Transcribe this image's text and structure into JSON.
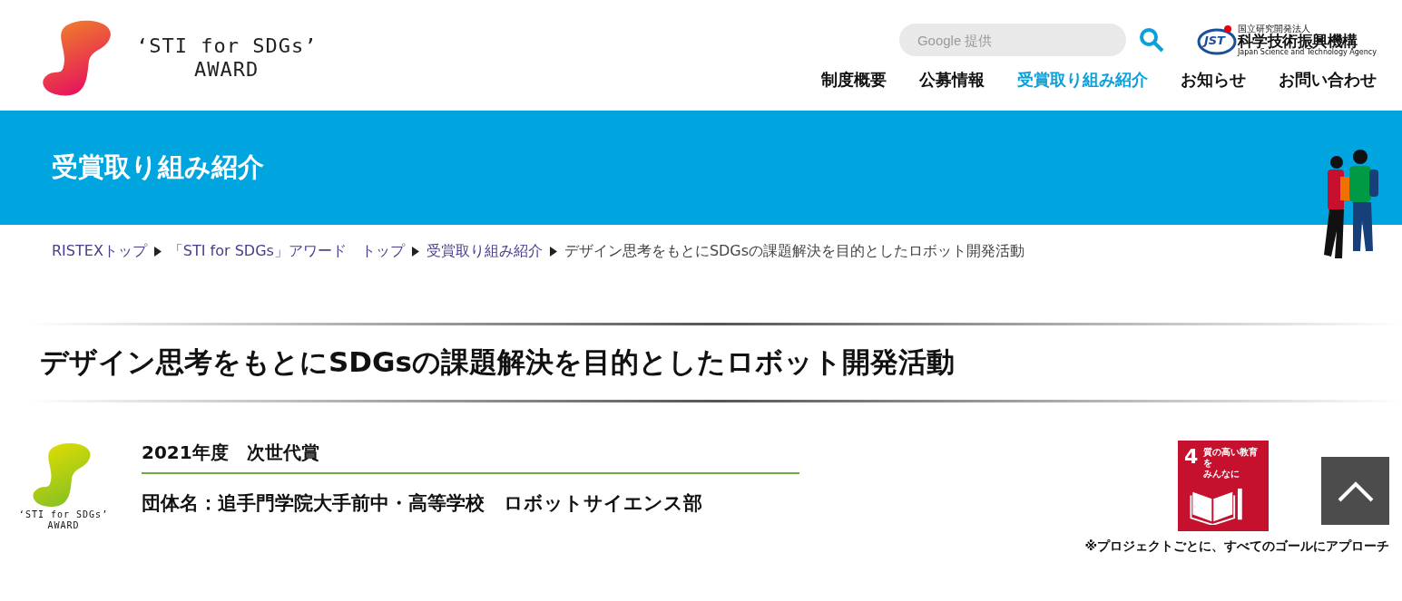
{
  "header": {
    "logo": {
      "line1": "‘STI for SDGs’",
      "line2": "AWARD"
    },
    "search": {
      "placeholder": "Google 提供"
    },
    "org": {
      "small": "国立研究開発法人",
      "name": "科学技術振興機構",
      "english": "Japan Science and Technology Agency",
      "mark": "JST"
    },
    "nav": [
      {
        "label": "制度概要",
        "selected": false
      },
      {
        "label": "公募情報",
        "selected": false
      },
      {
        "label": "受賞取り組み紹介",
        "selected": true
      },
      {
        "label": "お知らせ",
        "selected": false
      },
      {
        "label": "お問い合わせ",
        "selected": false
      }
    ]
  },
  "banner": {
    "title": "受賞取り組み紹介"
  },
  "breadcrumb": [
    {
      "label": "RISTEXトップ",
      "current": false
    },
    {
      "label": "「STI for SDGs」アワード　トップ",
      "current": false
    },
    {
      "label": "受賞取り組み紹介",
      "current": false
    },
    {
      "label": "デザイン思考をもとにSDGsの課題解決を目的としたロボット開発活動",
      "current": true
    }
  ],
  "page_title": "デザイン思考をもとにSDGsの課題解決を目的としたロボット開発活動",
  "award": {
    "logo": {
      "line1": "‘STI for SDGs’",
      "line2": "AWARD"
    },
    "category": "2021年度　次世代賞",
    "group": "団体名：追手門学院大手前中・高等学校　ロボットサイエンス部"
  },
  "sdg": {
    "number": "4",
    "label_line1": "質の高い教育を",
    "label_line2": "みんなに",
    "note": "※プロジェクトごとに、すべてのゴールにアプローチ"
  }
}
